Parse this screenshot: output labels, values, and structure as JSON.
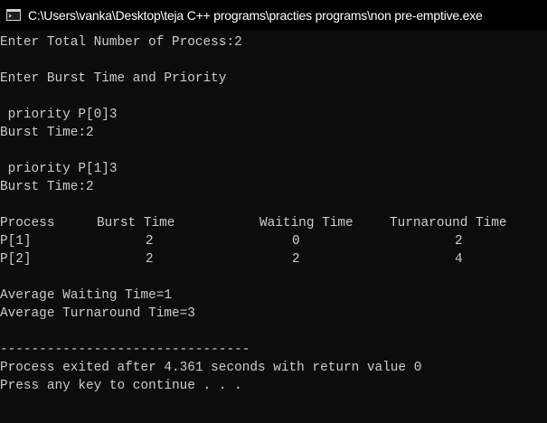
{
  "window": {
    "title": "C:\\Users\\vanka\\Desktop\\teja C++ programs\\practies programs\\non pre-emptive.exe",
    "icon": "console-app-icon"
  },
  "console": {
    "line_total": "Enter Total Number of Process:2",
    "line_enter_bt": "Enter Burst Time and Priority",
    "line_prio0": " priority P[0]3",
    "line_bt0": "Burst Time:2",
    "line_prio1": " priority P[1]3",
    "line_bt1": "Burst Time:2",
    "table": {
      "headers": [
        "Process",
        "Burst Time",
        "Waiting Time",
        "Turnaround Time"
      ],
      "rows": [
        [
          "P[1]",
          "2",
          "0",
          "2"
        ],
        [
          "P[2]",
          "2",
          "2",
          "4"
        ]
      ]
    },
    "line_avg_wait": "Average Waiting Time=1",
    "line_avg_tat": "Average Turnaround Time=3",
    "separator": "--------------------------------",
    "line_exit": "Process exited after 4.361 seconds with return value 0",
    "line_press": "Press any key to continue . . ."
  },
  "colors": {
    "background": "#0c0c0c",
    "text": "#cccccc",
    "titlebar": "#000000"
  }
}
